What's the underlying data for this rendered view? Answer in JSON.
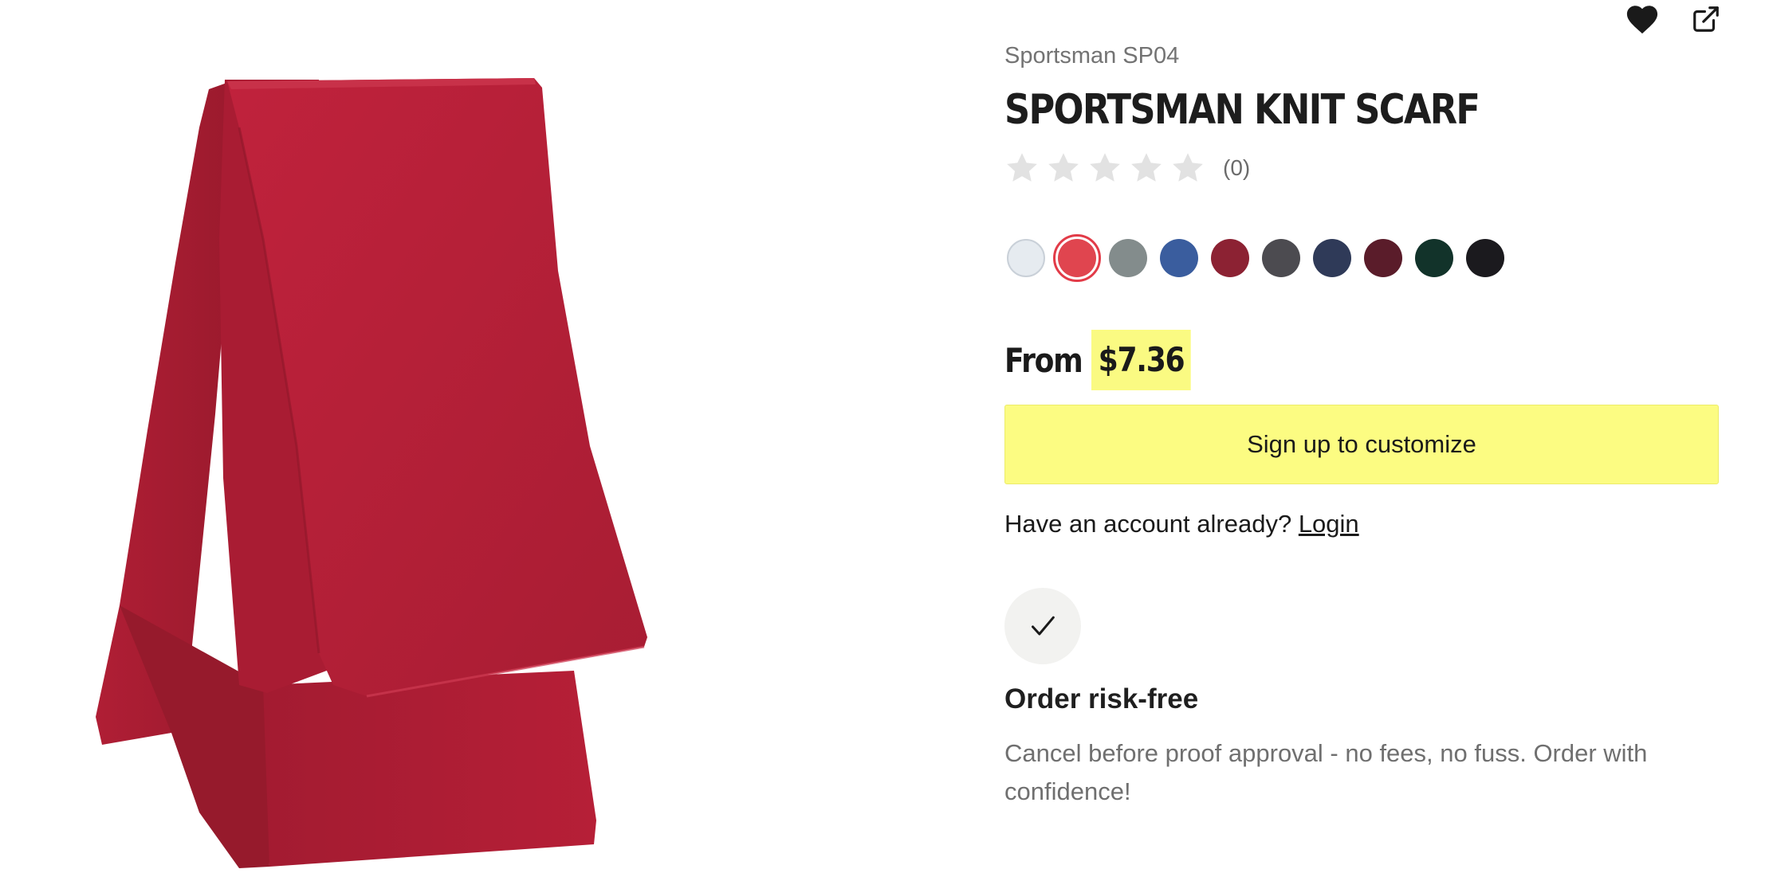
{
  "product": {
    "sku": "Sportsman SP04",
    "title": "SPORTSMAN KNIT SCARF",
    "rating_count": "(0)",
    "rating_stars": 0,
    "image_icon": "red-knit-scarf-image"
  },
  "actions": {
    "favorite_icon": "heart-icon",
    "share_icon": "external-link-icon"
  },
  "swatches": [
    {
      "name": "light-grey",
      "color": "#e6ebf0"
    },
    {
      "name": "red",
      "color": "#e0454f",
      "selected": true
    },
    {
      "name": "grey",
      "color": "#838c8c"
    },
    {
      "name": "royal-blue",
      "color": "#3a5d9e"
    },
    {
      "name": "cardinal",
      "color": "#8c2233"
    },
    {
      "name": "charcoal",
      "color": "#4c4b50"
    },
    {
      "name": "navy",
      "color": "#2f3a58"
    },
    {
      "name": "maroon",
      "color": "#5a1c2a"
    },
    {
      "name": "forest-green",
      "color": "#12332a"
    },
    {
      "name": "black",
      "color": "#1b1a1e"
    }
  ],
  "price": {
    "prefix": "From",
    "amount": "$7.36",
    "highlight_color": "#fafa82"
  },
  "cta": {
    "label": "Sign up to customize",
    "color": "#fcfc82"
  },
  "account": {
    "text": "Have an account already?",
    "login_label": "Login"
  },
  "risk": {
    "icon": "check-icon",
    "title": "Order risk-free",
    "text": "Cancel before proof approval - no fees, no fuss. Order with confidence!"
  }
}
